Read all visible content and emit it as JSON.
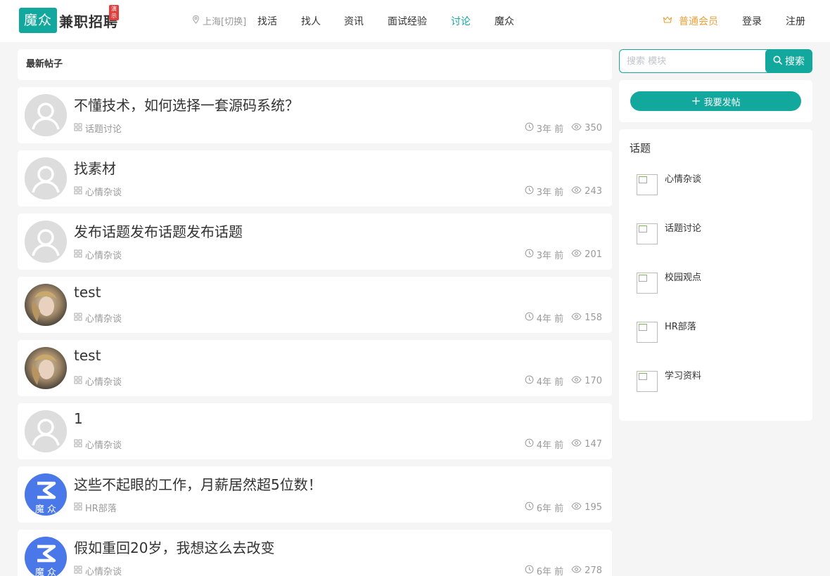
{
  "header": {
    "logo_box": "魔众",
    "logo_text": "兼职招聘",
    "logo_badge": "演示",
    "city": "上海[切换]",
    "nav": [
      "找活",
      "找人",
      "资讯",
      "面试经验",
      "讨论",
      "魔众"
    ],
    "active_nav": "讨论",
    "member": "普通会员",
    "login": "登录",
    "register": "注册"
  },
  "main": {
    "title": "最新帖子",
    "posts": [
      {
        "title": "不懂技术，如何选择一套源码系统？",
        "category": "话题讨论",
        "time": "3年 前",
        "views": "350",
        "avatar": "default"
      },
      {
        "title": "找素材",
        "category": "心情杂谈",
        "time": "3年 前",
        "views": "243",
        "avatar": "default"
      },
      {
        "title": "发布话题发布话题发布话题",
        "category": "心情杂谈",
        "time": "3年 前",
        "views": "201",
        "avatar": "default"
      },
      {
        "title": "test",
        "category": "心情杂谈",
        "time": "4年 前",
        "views": "158",
        "avatar": "photo"
      },
      {
        "title": "test",
        "category": "心情杂谈",
        "time": "4年 前",
        "views": "170",
        "avatar": "photo"
      },
      {
        "title": "1",
        "category": "心情杂谈",
        "time": "4年 前",
        "views": "147",
        "avatar": "default"
      },
      {
        "title": "这些不起眼的工作，月薪居然超5位数！",
        "category": "HR部落",
        "time": "6年 前",
        "views": "195",
        "avatar": "brand"
      },
      {
        "title": "假如重回20岁，我想这么去改变",
        "category": "心情杂谈",
        "time": "6年 前",
        "views": "278",
        "avatar": "brand"
      }
    ]
  },
  "sidebar": {
    "search_placeholder": "搜索 模块",
    "search_button": "搜索",
    "post_button": "我要发帖",
    "topics_title": "话题",
    "topics": [
      "心情杂谈",
      "话题讨论",
      "校园观点",
      "HR部落",
      "学习资料"
    ]
  },
  "brand_avatar_text": "魔 众",
  "colors": {
    "accent": "#13a89e",
    "member": "#e6a23c",
    "badge": "#e0403d",
    "bg": "#f5f5f5"
  }
}
